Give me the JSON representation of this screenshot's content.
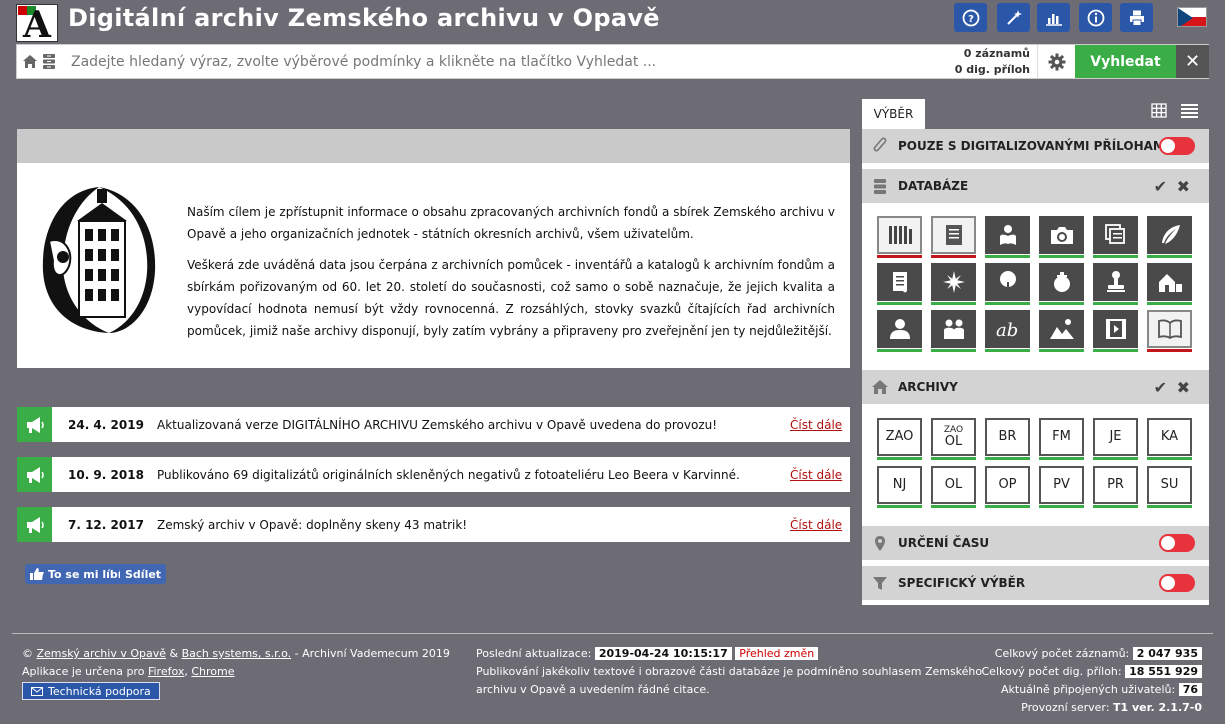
{
  "header": {
    "title": "Digitální archiv Zemského archivu v Opavě",
    "logo_letter": "A"
  },
  "search": {
    "placeholder": "Zadejte hledaný výraz, zvolte výběrové podmínky a klikněte na tlačítko Vyhledat ...",
    "records_count": "0 záznamů",
    "attachments_count": "0 dig. příloh",
    "search_label": "Vyhledat",
    "clear_label": "✕"
  },
  "intro": {
    "paragraph1": "Naším cílem je zpřístupnit informace o obsahu zpracovaných archivních fondů a sbírek Zemského archivu v Opavě a jeho organizačních jednotek - státních okresních archivů, všem uživatelům.",
    "paragraph2": "Veškerá zde uváděná data jsou čerpána z archivních pomůcek - inventářů a katalogů k archivním fondům a sbírkám pořizovaným od 60. let 20. století do současnosti, což samo o sobě naznačuje, že jejich kvalita a vypovídací hodnota nemusí být vždy rovnocenná. Z rozsáhlých, stovky svazků čítajících řad archivních pomůcek, jimiž naše archivy disponují, byly zatím vybrány a připraveny pro zveřejnění jen ty nejdůležitější."
  },
  "news": [
    {
      "date": "24. 4. 2019",
      "text": "Aktualizovaná verze DIGITÁLNÍHO ARCHIVU Zemského archivu v Opavě uvedena do provozu!",
      "more": "Číst dále"
    },
    {
      "date": "10. 9. 2018",
      "text": "Publikováno 69 digitalizátů originálních skleněných negativů z fotoateliéru Leo Beera v Karvinné.",
      "more": "Číst dále"
    },
    {
      "date": "7. 12. 2017",
      "text": "Zemský archiv v Opavě: doplněny skeny 43 matrik!",
      "more": "Číst dále"
    }
  ],
  "social": {
    "like": "To se mi líbí",
    "share": "Sdílet"
  },
  "panel": {
    "tab": "VÝBĚR",
    "digital_only": "POUZE S DIGITALIZOVANÝMI PŘÍLOHAMI",
    "databases": "DATABÁZE",
    "archives": "ARCHIVY",
    "time": "URČENÍ ČASU",
    "specific": "SPECIFICKÝ VÝBĚR",
    "archive_tiles": [
      {
        "top": "",
        "label": "ZAO"
      },
      {
        "top": "ZAO",
        "label": "OL"
      },
      {
        "top": "",
        "label": "BR"
      },
      {
        "top": "",
        "label": "FM"
      },
      {
        "top": "",
        "label": "JE"
      },
      {
        "top": "",
        "label": "KA"
      },
      {
        "top": "",
        "label": "NJ"
      },
      {
        "top": "",
        "label": "OL"
      },
      {
        "top": "",
        "label": "OP"
      },
      {
        "top": "",
        "label": "PV"
      },
      {
        "top": "",
        "label": "PR"
      },
      {
        "top": "",
        "label": "SU"
      }
    ],
    "db_tiles": [
      {
        "icon": "archive-shelf-icon",
        "state": "off"
      },
      {
        "icon": "document-icon",
        "state": "off"
      },
      {
        "icon": "reader-icon",
        "state": "on"
      },
      {
        "icon": "camera-icon",
        "state": "on"
      },
      {
        "icon": "copies-icon",
        "state": "on"
      },
      {
        "icon": "quill-icon",
        "state": "on"
      },
      {
        "icon": "scroll-icon",
        "state": "on"
      },
      {
        "icon": "compass-star-icon",
        "state": "on"
      },
      {
        "icon": "tree-icon",
        "state": "on"
      },
      {
        "icon": "seal-icon",
        "state": "on"
      },
      {
        "icon": "stamp-icon",
        "state": "on"
      },
      {
        "icon": "farm-icon",
        "state": "on"
      },
      {
        "icon": "person-icon",
        "state": "on"
      },
      {
        "icon": "people-icon",
        "state": "on"
      },
      {
        "icon": "handwriting-icon",
        "state": "on"
      },
      {
        "icon": "landscape-icon",
        "state": "on"
      },
      {
        "icon": "film-icon",
        "state": "on"
      },
      {
        "icon": "book-icon",
        "state": "off"
      }
    ]
  },
  "footer": {
    "copyright_prefix": "©",
    "org": "Zemský archiv v Opavě",
    "amp": "&",
    "vendor": "Bach systems, s.r.o.",
    "suffix": "- Archivní Vademecum 2019",
    "apps_prefix": "Aplikace je určena pro",
    "firefox": "Firefox",
    "chrome": "Chrome",
    "support": "Technická podpora",
    "last_update_label": "Poslední aktualizace:",
    "last_update": "2019-04-24 10:15:17",
    "changes": "Přehled změn",
    "notice1": "Publikování jakékoliv textové i obrazové části databáze je podmíněno souhlasem Zemského",
    "notice2": "archivu v Opavě a uvedením řádné citace.",
    "total_records_label": "Celkový počet záznamů:",
    "total_records": "2 047 935",
    "total_attachments_label": "Celkový počet dig. příloh:",
    "total_attachments": "18 551 929",
    "users_label": "Aktuálně připojených uživatelů:",
    "users": "76",
    "server_label": "Provozní server:",
    "server": "T1 ver. 2.1.7-0"
  },
  "colors": {
    "accent": "#3aad47",
    "brand_blue": "#2b57a8",
    "toggle_off": "#e8323c",
    "background": "#6d6c75"
  }
}
